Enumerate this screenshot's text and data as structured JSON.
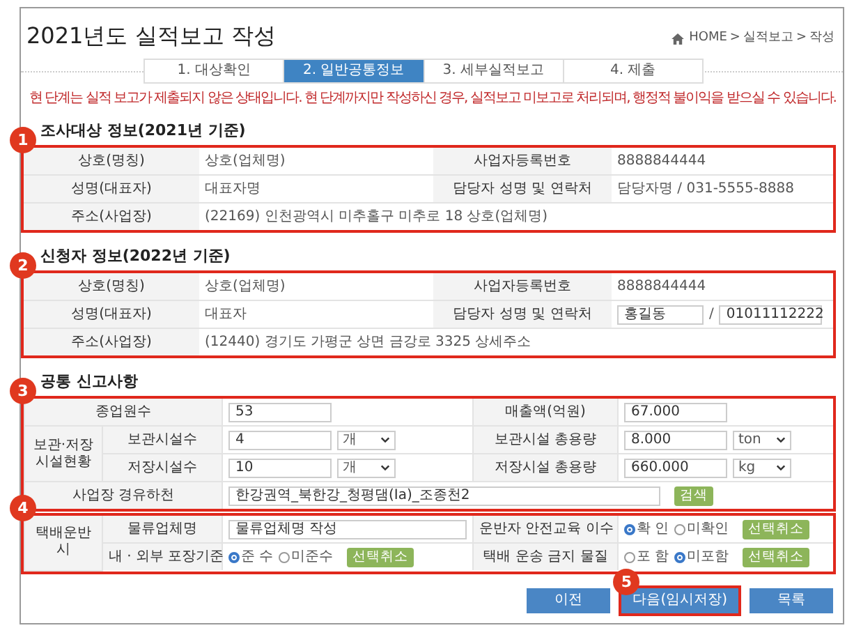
{
  "page_title": "2021년도 실적보고 작성",
  "breadcrumb": {
    "items": [
      "HOME",
      "실적보고",
      "작성"
    ],
    "separator": ">"
  },
  "steps": [
    {
      "label": "1. 대상확인",
      "selected": false
    },
    {
      "label": "2. 일반공통정보",
      "selected": true
    },
    {
      "label": "3. 세부실적보고",
      "selected": false
    },
    {
      "label": "4. 제출",
      "selected": false
    }
  ],
  "warning": "현 단계는 실적 보고가 제출되지 않은 상태입니다. 현 단계까지만 작성하신 경우, 실적보고 미보고로 처리되며, 행정적 불이익을 받으실 수 있습니다.",
  "sections": [
    {
      "title": "조사대상 정보(2021년 기준)",
      "blocks": [
        {
          "badge": "1",
          "rows": [
            {
              "cells": [
                {
                  "kind": "label",
                  "text": "상호(명칭)"
                },
                {
                  "kind": "text",
                  "text": "상호(업체명)"
                },
                {
                  "kind": "label",
                  "text": "사업자등록번호"
                },
                {
                  "kind": "text",
                  "text": "8888844444"
                }
              ]
            },
            {
              "cells": [
                {
                  "kind": "label",
                  "text": "성명(대표자)"
                },
                {
                  "kind": "text",
                  "text": "대표자명"
                },
                {
                  "kind": "label",
                  "text": "담당자 성명 및 연락처"
                },
                {
                  "kind": "text",
                  "text": "담당자명 / 031-5555-8888"
                }
              ]
            },
            {
              "cells": [
                {
                  "kind": "label",
                  "text": "주소(사업장)"
                },
                {
                  "kind": "text",
                  "text": "(22169) 인천광역시 미추홀구 미추로 18 상호(업체명)",
                  "colspan": 3
                }
              ]
            }
          ]
        }
      ]
    },
    {
      "title": "신청자 정보(2022년 기준)",
      "blocks": [
        {
          "badge": "2",
          "rows": [
            {
              "cells": [
                {
                  "kind": "label",
                  "text": "상호(명칭)"
                },
                {
                  "kind": "text",
                  "text": "상호(업체명)"
                },
                {
                  "kind": "label",
                  "text": "사업자등록번호"
                },
                {
                  "kind": "text",
                  "text": "8888844444"
                }
              ]
            },
            {
              "cells": [
                {
                  "kind": "label",
                  "text": "성명(대표자)"
                },
                {
                  "kind": "text",
                  "text": "대표자"
                },
                {
                  "kind": "label",
                  "text": "담당자 성명 및 연락처"
                },
                {
                  "kind": "contact",
                  "name": "홍길동",
                  "separator": "/",
                  "phone": "01011112222"
                }
              ]
            },
            {
              "cells": [
                {
                  "kind": "label",
                  "text": "주소(사업장)"
                },
                {
                  "kind": "text",
                  "text": "(12440) 경기도 가평군 상면 금강로 3325 상세주소",
                  "colspan": 3
                }
              ]
            }
          ]
        }
      ]
    },
    {
      "title": "공통 신고사항",
      "blocks": [
        {
          "badge": "3",
          "rows": [
            {
              "cells": [
                {
                  "kind": "label",
                  "text": "종업원수",
                  "colspan": 2
                },
                {
                  "kind": "input",
                  "value": "53"
                },
                {
                  "kind": "label",
                  "text": "매출액(억원)"
                },
                {
                  "kind": "input",
                  "value": "67.000"
                }
              ]
            },
            {
              "cells": [
                {
                  "kind": "group_label",
                  "text": "보관·저장 시설현황",
                  "rowspan": 2
                },
                {
                  "kind": "label",
                  "text": "보관시설수"
                },
                {
                  "kind": "measure",
                  "value": "4",
                  "unit": "개"
                },
                {
                  "kind": "label",
                  "text": "보관시설 총용량"
                },
                {
                  "kind": "measure",
                  "value": "8.000",
                  "unit": "ton"
                }
              ]
            },
            {
              "cells": [
                {
                  "kind": "label",
                  "text": "저장시설수"
                },
                {
                  "kind": "measure",
                  "value": "10",
                  "unit": "개"
                },
                {
                  "kind": "label",
                  "text": "저장시설 총용량"
                },
                {
                  "kind": "measure",
                  "value": "660.000",
                  "unit": "kg"
                }
              ]
            },
            {
              "cells": [
                {
                  "kind": "label",
                  "text": "사업장 경유하천",
                  "colspan": 2
                },
                {
                  "kind": "search",
                  "value": "한강권역_북한강_청평댐(Ⅰa)_조종천2",
                  "button": "검색",
                  "colspan": 3
                }
              ]
            }
          ]
        },
        {
          "badge": "4",
          "rows": [
            {
              "cells": [
                {
                  "kind": "group_label",
                  "text": "택배운반시",
                  "rowspan": 2
                },
                {
                  "kind": "label",
                  "text": "물류업체명"
                },
                {
                  "kind": "wide_input",
                  "value": "물류업체명 작성"
                },
                {
                  "kind": "label",
                  "text": "운반자 안전교육 이수"
                },
                {
                  "kind": "radios",
                  "options": [
                    {
                      "label": "확 인",
                      "selected": true
                    },
                    {
                      "label": "미확인",
                      "selected": false
                    }
                  ],
                  "button": "선택취소"
                }
              ]
            },
            {
              "cells": [
                {
                  "kind": "label",
                  "text": "내 · 외부 포장기준"
                },
                {
                  "kind": "radios",
                  "options": [
                    {
                      "label": "준 수",
                      "selected": true
                    },
                    {
                      "label": "미준수",
                      "selected": false
                    }
                  ],
                  "button": "선택취소"
                },
                {
                  "kind": "label",
                  "text": "택배 운송 금지 물질"
                },
                {
                  "kind": "radios",
                  "options": [
                    {
                      "label": "포 함",
                      "selected": false
                    },
                    {
                      "label": "미포함",
                      "selected": true
                    }
                  ],
                  "button": "선택취소"
                }
              ]
            }
          ]
        }
      ]
    }
  ],
  "buttons": [
    {
      "label": "이전"
    },
    {
      "label": "다음(임시저장)",
      "badge": "5"
    },
    {
      "label": "목록"
    }
  ]
}
